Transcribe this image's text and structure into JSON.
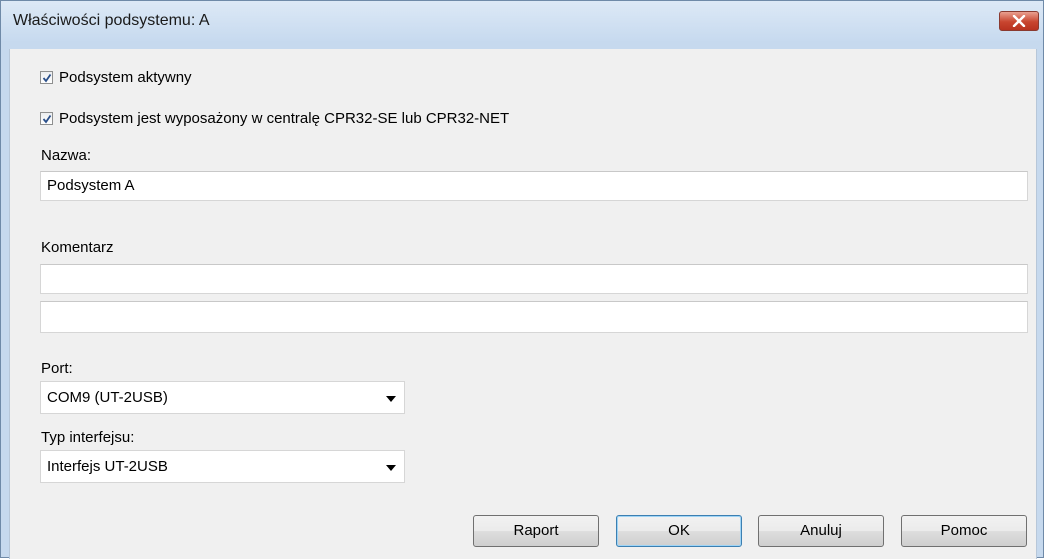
{
  "window": {
    "title": "Właściwości podsystemu: A"
  },
  "options": {
    "active_label": "Podsystem aktywny",
    "active_checked": true,
    "central_label": "Podsystem jest wyposażony w centralę CPR32-SE lub CPR32-NET",
    "central_checked": true
  },
  "name": {
    "label": "Nazwa:",
    "value": "Podsystem A"
  },
  "comment": {
    "label": "Komentarz",
    "line1": "",
    "line2": ""
  },
  "port": {
    "label": "Port:",
    "selected": "COM9 (UT-2USB)"
  },
  "interface": {
    "label": "Typ interfejsu:",
    "selected": "Interfejs UT-2USB"
  },
  "buttons": {
    "report": "Raport",
    "ok": "OK",
    "cancel": "Anuluj",
    "help": "Pomoc"
  }
}
